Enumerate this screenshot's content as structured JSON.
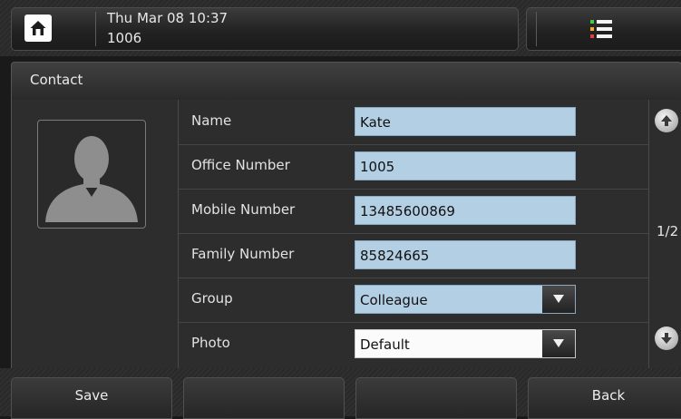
{
  "status_bar": {
    "datetime": "Thu Mar 08 10:37",
    "extension": "1006",
    "home_icon": "home-icon",
    "menu_icon": "list-menu-icon"
  },
  "screen": {
    "title": "Contact"
  },
  "form": {
    "fields": [
      {
        "label": "Name",
        "value": "Kate"
      },
      {
        "label": "Office Number",
        "value": "1005"
      },
      {
        "label": "Mobile Number",
        "value": "13485600869"
      },
      {
        "label": "Family Number",
        "value": "85824665"
      },
      {
        "label": "Group",
        "value": "Colleague"
      },
      {
        "label": "Photo",
        "value": "Default"
      }
    ]
  },
  "pager": {
    "page": "1/2",
    "up_icon": "arrow-up-icon",
    "down_icon": "arrow-down-icon"
  },
  "softkeys": [
    "Save",
    "",
    "",
    "Back"
  ],
  "colors": {
    "field_bg": "#b3cfe4",
    "white_field_bg": "#fbfbfb",
    "background": "#2d2d2d"
  }
}
